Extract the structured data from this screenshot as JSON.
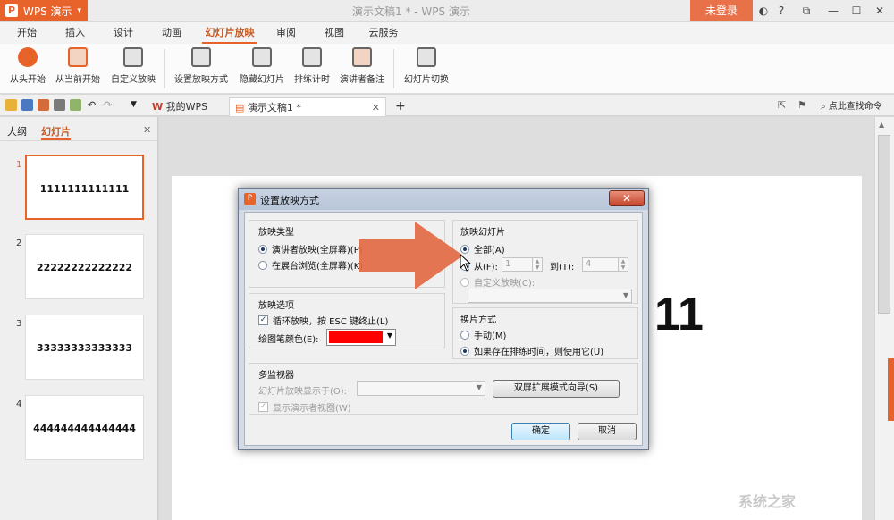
{
  "app": {
    "name": "WPS 演示",
    "logo_letter": "P",
    "doc_title": "演示文稿1 * - WPS 演示",
    "login_label": "未登录",
    "help_label": "?"
  },
  "tabs": [
    "开始",
    "插入",
    "设计",
    "动画",
    "幻灯片放映",
    "审阅",
    "视图",
    "云服务"
  ],
  "active_tab": "幻灯片放映",
  "ribbon": [
    {
      "label": "从头开始",
      "icon": "play-icon",
      "color": "#e8632a"
    },
    {
      "label": "从当前开始",
      "icon": "play-current-icon",
      "color": "#e8632a"
    },
    {
      "label": "自定义放映",
      "icon": "custom-show-icon",
      "color": "#555555"
    },
    {
      "label": "设置放映方式",
      "icon": "setup-show-icon",
      "color": "#555555"
    },
    {
      "label": "隐藏幻灯片",
      "icon": "hide-slide-icon",
      "color": "#555555"
    },
    {
      "label": "排练计时",
      "icon": "rehearse-timing-icon",
      "color": "#555555"
    },
    {
      "label": "演讲者备注",
      "icon": "speaker-notes-icon",
      "color": "#555555"
    },
    {
      "label": "幻灯片切换",
      "icon": "transition-icon",
      "color": "#555555"
    }
  ],
  "doc_tabs": {
    "wps": "我的WPS",
    "doc": "演示文稿1 *",
    "add": "+",
    "search": "点此查找命令"
  },
  "left_panel": {
    "tab_outline": "大纲",
    "tab_slides": "幻灯片",
    "close": "✕"
  },
  "slides": [
    {
      "num": "1",
      "text": "1111111111111"
    },
    {
      "num": "2",
      "text": "22222222222222"
    },
    {
      "num": "3",
      "text": "33333333333333"
    },
    {
      "num": "4",
      "text": "444444444444444"
    }
  ],
  "canvas_text": "11",
  "dialog": {
    "title": "设置放映方式",
    "close": "✕",
    "show_type": {
      "title": "放映类型",
      "opt1": "演讲者放映(全屏幕)(P)",
      "opt2": "在展台浏览(全屏幕)(K)"
    },
    "show_slides": {
      "title": "放映幻灯片",
      "all": "全部(A)",
      "from": "从(F):",
      "from_val": "1",
      "to": "到(T):",
      "to_val": "4",
      "custom": "自定义放映(C):"
    },
    "show_options": {
      "title": "放映选项",
      "loop": "循环放映，按 ESC 键终止(L)",
      "pen_color": "绘图笔颜色(E):",
      "pen_color_value": "#ff0000"
    },
    "advance": {
      "title": "换片方式",
      "manual": "手动(M)",
      "timing": "如果存在排练时间，则使用它(U)"
    },
    "monitors": {
      "title": "多监视器",
      "display_on": "幻灯片放映显示于(O):",
      "wizard": "双屏扩展模式向导(S)",
      "presenter_view": "显示演示者视图(W)"
    },
    "ok": "确定",
    "cancel": "取消"
  },
  "watermark": "系统之家"
}
